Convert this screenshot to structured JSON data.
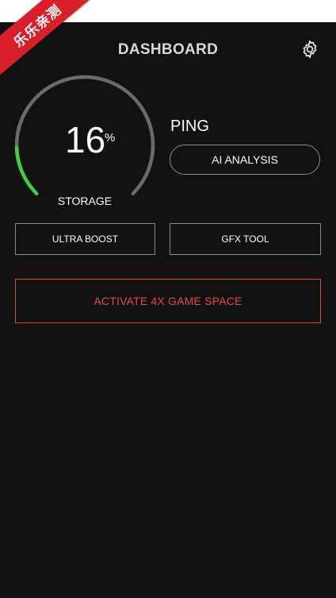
{
  "watermark": {
    "text": "乐乐亲测"
  },
  "header": {
    "title": "DASHBOARD",
    "settings_icon": "gear-icon"
  },
  "storage": {
    "value": "16",
    "unit": "%",
    "label": "STORAGE",
    "percent": 16
  },
  "ping": {
    "label": "PING"
  },
  "buttons": {
    "ai_analysis": "AI ANALYSIS",
    "ultra_boost": "ULTRA BOOST",
    "gfx_tool": "GFX TOOL",
    "activate": "ACTIVATE 4X GAME SPACE"
  },
  "colors": {
    "background": "#121212",
    "gauge_track": "#6b6b6b",
    "gauge_fill": "#3fcf3a",
    "accent_red": "#ea4a3f"
  }
}
